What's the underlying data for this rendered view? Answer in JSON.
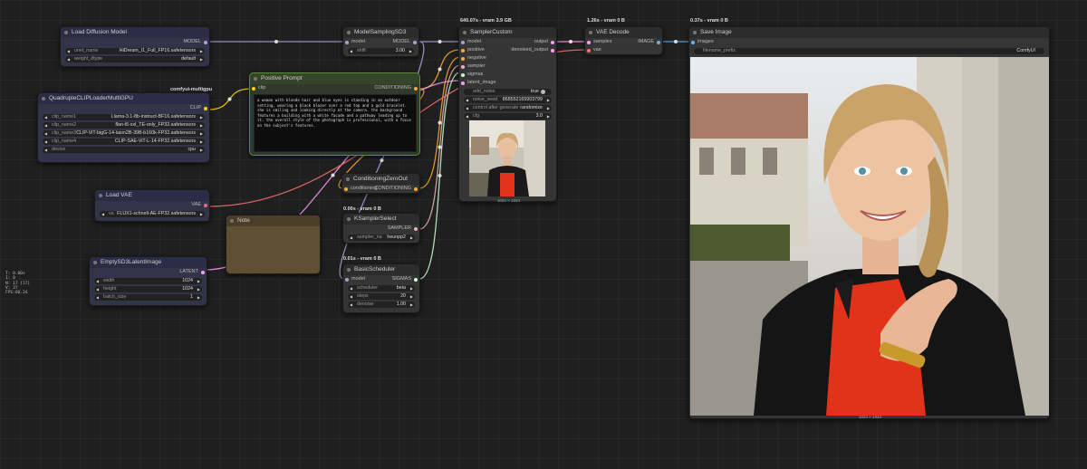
{
  "colors": {
    "model": "#b39ddb",
    "clip": "#ffd500",
    "conditioning": "#ffa931",
    "vae": "#ff6e6e",
    "latent": "#ff9cf9",
    "image": "#64b5f6",
    "sampler": "#ecb4b4",
    "sigmas": "#cdffcd",
    "string": "#77ff77"
  },
  "badges": {
    "sampler_custom": "640.07s - vram 3.9 GB",
    "vae_decode": "1.26s - vram 0 B",
    "save_image": "0.37s - vram 0 B",
    "ksampler_select": "0.00s - vram 0 B",
    "basic_scheduler": "0.01s - vram 0 B",
    "multigpu": "comfyui-multigpu"
  },
  "nodes": {
    "load_diffusion": {
      "title": "Load Diffusion Model",
      "out_model": "MODEL",
      "unet_name_label": "unet_name",
      "unet_name": "HiDream_I1_Full_FP16.safetensors",
      "weight_dtype_label": "weight_dtype",
      "weight_dtype": "default"
    },
    "quad_clip": {
      "title": "QuadrupleCLIPLoaderMultiGPU",
      "out_clip": "CLIP",
      "clip_name1_label": "clip_name1",
      "clip_name1": "Llama-3.1-8b-instruct-BF16.safetensors",
      "clip_name2_label": "clip_name2",
      "clip_name2": "flan-t5-xxl_TE-only_FP32.safetensors",
      "clip_name3_label": "clip_name3",
      "clip_name3": "CLIP-ViT-bigG-14-laion2B-39B-b160k-FP32.safetensors",
      "clip_name4_label": "clip_name4",
      "clip_name4": "CLIP-SAE-ViT-L-14-FP32.safetensors",
      "device_label": "device",
      "device": "cpu"
    },
    "load_vae": {
      "title": "Load VAE",
      "out_vae": "VAE",
      "vae_name_label": "va",
      "vae_name": "FLUX1-schnell-AE-FP32.safetensors"
    },
    "empty_latent": {
      "title": "EmptySD3LatentImage",
      "out_latent": "LATENT",
      "width_label": "width",
      "width": "1024",
      "height_label": "height",
      "height": "1024",
      "batch_label": "batch_size",
      "batch": "1"
    },
    "note": {
      "title": "Note"
    },
    "positive_prompt": {
      "title": "Positive Prompt",
      "in_clip": "clip",
      "out_cond": "CONDITIONING",
      "text": "a woman with blonde hair and blue eyes is standing in an outdoor setting, wearing a black blazer over a red top and a gold bracelet. she is smiling and looking directly at the camera. the background features a building with a white facade and a pathway leading up to it. the overall style of the photograph is professional, with a focus on the subject's features."
    },
    "model_sampling": {
      "title": "ModelSamplingSD3",
      "in_model": "model",
      "out_model": "MODEL",
      "shift_label": "shift",
      "shift": "3.00"
    },
    "cond_zero": {
      "title": "ConditioningZeroOut",
      "in_cond": "conditioning",
      "out_cond": "CONDITIONING"
    },
    "ksampler_select": {
      "title": "KSamplerSelect",
      "out_sampler": "SAMPLER",
      "sampler_label": "sampler_na",
      "sampler": "heunpp2"
    },
    "basic_scheduler": {
      "title": "BasicScheduler",
      "in_model": "model",
      "out_sigmas": "SIGMAS",
      "scheduler_label": "scheduler",
      "scheduler": "beta",
      "steps_label": "steps",
      "steps": "20",
      "denoise_label": "denoise",
      "denoise": "1.00"
    },
    "sampler_custom": {
      "title": "SamplerCustom",
      "in_model": "model",
      "in_positive": "positive",
      "in_negative": "negative",
      "in_sampler": "sampler",
      "in_sigmas": "sigmas",
      "in_latent": "latent_image",
      "out_output": "output",
      "out_denoised": "denoised_output",
      "add_noise_label": "add_noise",
      "add_noise": "true",
      "noise_seed_label": "noise_seed",
      "noise_seed": "868552165903799",
      "control_label": "control after generate",
      "control": "randomize",
      "cfg_label": "cfg",
      "cfg": "3.0",
      "preview_size": "1024 × 1024"
    },
    "vae_decode": {
      "title": "VAE Decode",
      "in_samples": "samples",
      "in_vae": "vae",
      "out_image": "IMAGE"
    },
    "save_image": {
      "title": "Save Image",
      "in_images": "images",
      "prefix_label": "filename_prefix",
      "prefix": "ComfyUI",
      "image_size": "1024 × 1024"
    }
  },
  "stats": [
    "T: 0.00s",
    "I: 0",
    "N: 17 [17]",
    "V: 37",
    "FPS:60.24"
  ]
}
